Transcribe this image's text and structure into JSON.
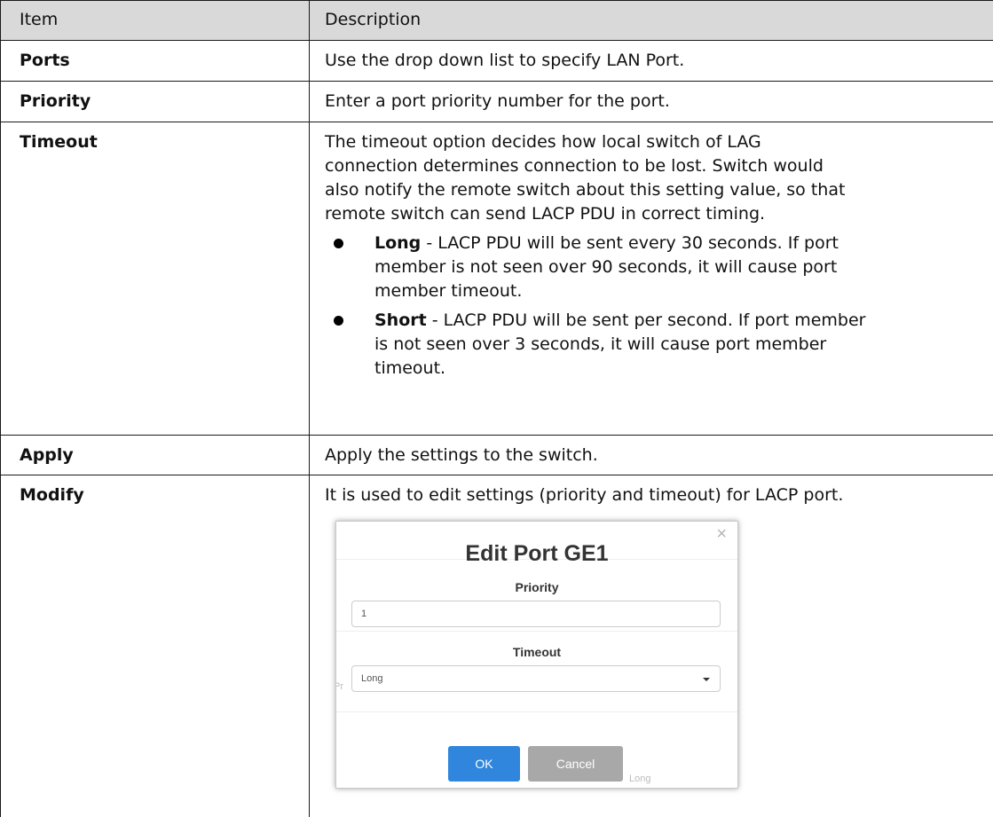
{
  "table": {
    "headers": {
      "item": "Item",
      "description": "Description"
    },
    "rows": [
      {
        "item": "Ports",
        "description": "Use the drop down list to specify LAN Port."
      },
      {
        "item": "Priority",
        "description": "Enter a port priority number for the port."
      },
      {
        "item": "Timeout",
        "description_lines": [
          "The timeout option decides how local switch of LAG",
          "connection determines connection to be lost. Switch would",
          "also notify the remote switch about this setting value, so that",
          "remote switch can send LACP PDU in correct timing."
        ],
        "bullets": [
          {
            "term": "Long",
            "lines": [
              " - LACP PDU will be sent every 30 seconds. If port",
              "member is not seen over 90 seconds, it will cause port",
              "member timeout."
            ]
          },
          {
            "term": "Short",
            "lines": [
              " - LACP PDU will be sent per second. If port member",
              "is not seen over 3 seconds, it will cause port member",
              "timeout."
            ]
          }
        ]
      },
      {
        "item": "Apply",
        "description": "Apply the settings to the switch."
      },
      {
        "item": "Modify",
        "description": "It is used to edit settings (priority and timeout) for LACP port."
      }
    ]
  },
  "dialog": {
    "title": "Edit Port GE1",
    "close_glyph": "×",
    "priority_label": "Priority",
    "priority_value": "1",
    "timeout_label": "Timeout",
    "timeout_value": "Long",
    "ok_label": "OK",
    "cancel_label": "Cancel",
    "background_fragments": {
      "left": "Pr",
      "bottom": "Long"
    },
    "colors": {
      "ok": "#2f86dc",
      "cancel": "#a8a8a8"
    },
    "icons": {
      "close": "close-icon",
      "select_arrow": "caret-down-icon"
    }
  }
}
